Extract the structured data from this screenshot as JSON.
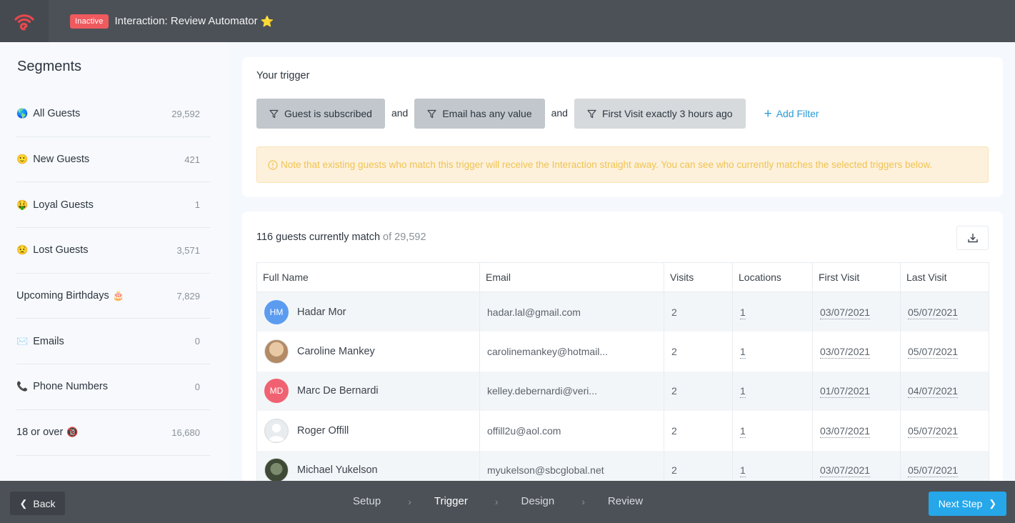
{
  "header": {
    "status_badge": "Inactive",
    "title": "Interaction: Review Automator",
    "title_emoji": "⭐",
    "logo_icon": "wifi-logo-icon"
  },
  "sidebar": {
    "title": "Segments",
    "items": [
      {
        "emoji": "🌎",
        "emoji_position": "before",
        "label": "All Guests",
        "count": "29,592"
      },
      {
        "emoji": "🙂",
        "emoji_position": "before",
        "label": "New Guests",
        "count": "421"
      },
      {
        "emoji": "🤑",
        "emoji_position": "before",
        "label": "Loyal Guests",
        "count": "1"
      },
      {
        "emoji": "😟",
        "emoji_position": "before",
        "label": "Lost Guests",
        "count": "3,571"
      },
      {
        "emoji": "🎂",
        "emoji_position": "after",
        "label": "Upcoming Birthdays",
        "count": "7,829"
      },
      {
        "emoji": "✉️",
        "emoji_position": "before",
        "label": "Emails",
        "count": "0"
      },
      {
        "emoji": "📞",
        "emoji_position": "before",
        "label": "Phone Numbers",
        "count": "0"
      },
      {
        "emoji": "🔞",
        "emoji_position": "after",
        "label": "18 or over",
        "count": "16,680"
      }
    ]
  },
  "trigger": {
    "title": "Your trigger",
    "filters": [
      {
        "label": "Guest is subscribed",
        "icon": "funnel-icon"
      },
      {
        "label": "Email has any value",
        "icon": "funnel-icon"
      },
      {
        "label": "First Visit exactly 3 hours ago",
        "icon": "funnel-icon"
      }
    ],
    "connector": "and",
    "add_filter_label": "Add Filter",
    "notice": "Note that existing guests who match this trigger will receive the Interaction straight away. You can see who currently matches the selected triggers below."
  },
  "guests": {
    "match_text": "116 guests currently match",
    "match_total": "of 29,592",
    "columns": [
      "Full Name",
      "Email",
      "Visits",
      "Locations",
      "First Visit",
      "Last Visit"
    ],
    "rows": [
      {
        "avatar_type": "initials",
        "initials": "HM",
        "avatar_color": "#5b9cf0",
        "name": "Hadar Mor",
        "email": "hadar.lal@gmail.com",
        "visits": "2",
        "locations": "1",
        "first_visit": "03/07/2021",
        "last_visit": "05/07/2021"
      },
      {
        "avatar_type": "photo",
        "initials": "",
        "avatar_color": "",
        "name": "Caroline Mankey",
        "email": "carolinemankey@hotmail...",
        "visits": "2",
        "locations": "1",
        "first_visit": "03/07/2021",
        "last_visit": "05/07/2021"
      },
      {
        "avatar_type": "initials",
        "initials": "MD",
        "avatar_color": "#f06271",
        "name": "Marc De Bernardi",
        "email": "kelley.debernardi@veri...",
        "visits": "2",
        "locations": "1",
        "first_visit": "01/07/2021",
        "last_visit": "04/07/2021"
      },
      {
        "avatar_type": "placeholder",
        "initials": "",
        "avatar_color": "",
        "name": "Roger Offill",
        "email": "offill2u@aol.com",
        "visits": "2",
        "locations": "1",
        "first_visit": "03/07/2021",
        "last_visit": "05/07/2021"
      },
      {
        "avatar_type": "photo2",
        "initials": "",
        "avatar_color": "",
        "name": "Michael Yukelson",
        "email": "myukelson@sbcglobal.net",
        "visits": "2",
        "locations": "1",
        "first_visit": "03/07/2021",
        "last_visit": "05/07/2021"
      }
    ]
  },
  "footer": {
    "back_label": "Back",
    "steps": [
      {
        "label": "Setup",
        "active": false
      },
      {
        "label": "Trigger",
        "active": true
      },
      {
        "label": "Design",
        "active": false
      },
      {
        "label": "Review",
        "active": false
      }
    ],
    "next_label": "Next Step"
  },
  "colors": {
    "brand_red": "#ef5a5f",
    "accent_blue": "#26a7ea",
    "link_blue": "#2b9bd8",
    "notice_text": "#f0c350",
    "notice_bg": "#fdf1dc"
  }
}
